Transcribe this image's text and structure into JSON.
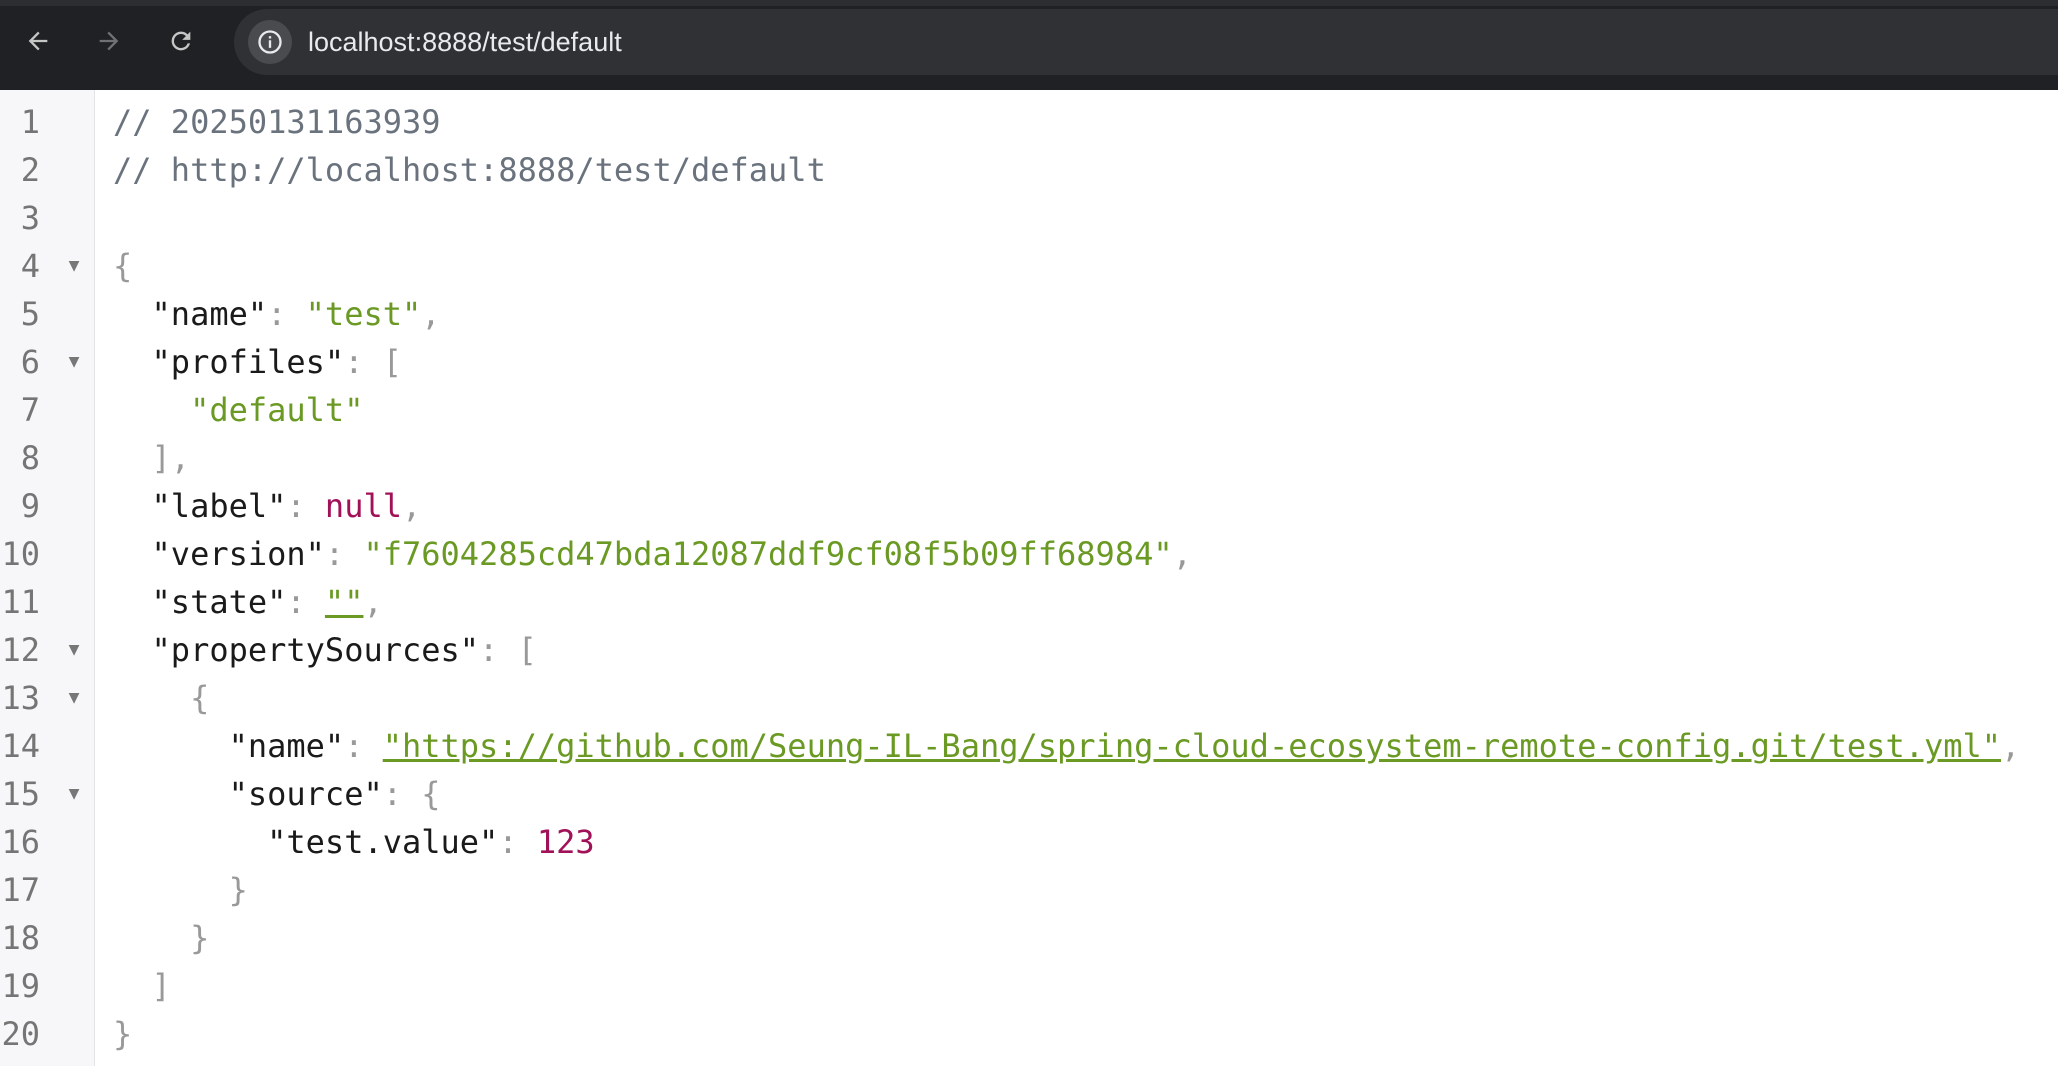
{
  "browser": {
    "url": "localhost:8888/test/default"
  },
  "lines": [
    {
      "n": "1",
      "fold": false,
      "indent": "",
      "parts": [
        {
          "t": "comment",
          "v": "// 20250131163939"
        }
      ]
    },
    {
      "n": "2",
      "fold": false,
      "indent": "",
      "parts": [
        {
          "t": "comment",
          "v": "// http://localhost:8888/test/default"
        }
      ]
    },
    {
      "n": "3",
      "fold": false,
      "indent": "",
      "parts": []
    },
    {
      "n": "4",
      "fold": true,
      "indent": "",
      "parts": [
        {
          "t": "punc",
          "v": "{"
        }
      ]
    },
    {
      "n": "5",
      "fold": false,
      "indent": "  ",
      "parts": [
        {
          "t": "key",
          "v": "\"name\""
        },
        {
          "t": "punc",
          "v": ": "
        },
        {
          "t": "str",
          "v": "\"test\""
        },
        {
          "t": "punc",
          "v": ","
        }
      ]
    },
    {
      "n": "6",
      "fold": true,
      "indent": "  ",
      "parts": [
        {
          "t": "key",
          "v": "\"profiles\""
        },
        {
          "t": "punc",
          "v": ": ["
        }
      ]
    },
    {
      "n": "7",
      "fold": false,
      "indent": "    ",
      "parts": [
        {
          "t": "str",
          "v": "\"default\""
        }
      ]
    },
    {
      "n": "8",
      "fold": false,
      "indent": "  ",
      "parts": [
        {
          "t": "punc",
          "v": "],"
        }
      ]
    },
    {
      "n": "9",
      "fold": false,
      "indent": "  ",
      "parts": [
        {
          "t": "key",
          "v": "\"label\""
        },
        {
          "t": "punc",
          "v": ": "
        },
        {
          "t": "null",
          "v": "null"
        },
        {
          "t": "punc",
          "v": ","
        }
      ]
    },
    {
      "n": "10",
      "fold": false,
      "indent": "  ",
      "parts": [
        {
          "t": "key",
          "v": "\"version\""
        },
        {
          "t": "punc",
          "v": ": "
        },
        {
          "t": "str",
          "v": "\"f7604285cd47bda12087ddf9cf08f5b09ff68984\""
        },
        {
          "t": "punc",
          "v": ","
        }
      ]
    },
    {
      "n": "11",
      "fold": false,
      "indent": "  ",
      "parts": [
        {
          "t": "key",
          "v": "\"state\""
        },
        {
          "t": "punc",
          "v": ": "
        },
        {
          "t": "link",
          "v": "\"\""
        },
        {
          "t": "punc",
          "v": ","
        }
      ]
    },
    {
      "n": "12",
      "fold": true,
      "indent": "  ",
      "parts": [
        {
          "t": "key",
          "v": "\"propertySources\""
        },
        {
          "t": "punc",
          "v": ": ["
        }
      ]
    },
    {
      "n": "13",
      "fold": true,
      "indent": "    ",
      "parts": [
        {
          "t": "punc",
          "v": "{"
        }
      ]
    },
    {
      "n": "14",
      "fold": false,
      "indent": "      ",
      "parts": [
        {
          "t": "key",
          "v": "\"name\""
        },
        {
          "t": "punc",
          "v": ": "
        },
        {
          "t": "link",
          "v": "\"https://github.com/Seung-IL-Bang/spring-cloud-ecosystem-remote-config.git/test.yml\""
        },
        {
          "t": "punc",
          "v": ","
        }
      ]
    },
    {
      "n": "15",
      "fold": true,
      "indent": "      ",
      "parts": [
        {
          "t": "key",
          "v": "\"source\""
        },
        {
          "t": "punc",
          "v": ": {"
        }
      ]
    },
    {
      "n": "16",
      "fold": false,
      "indent": "        ",
      "parts": [
        {
          "t": "key",
          "v": "\"test.value\""
        },
        {
          "t": "punc",
          "v": ": "
        },
        {
          "t": "num",
          "v": "123"
        }
      ]
    },
    {
      "n": "17",
      "fold": false,
      "indent": "      ",
      "parts": [
        {
          "t": "punc",
          "v": "}"
        }
      ]
    },
    {
      "n": "18",
      "fold": false,
      "indent": "    ",
      "parts": [
        {
          "t": "punc",
          "v": "}"
        }
      ]
    },
    {
      "n": "19",
      "fold": false,
      "indent": "  ",
      "parts": [
        {
          "t": "punc",
          "v": "]"
        }
      ]
    },
    {
      "n": "20",
      "fold": false,
      "indent": "",
      "parts": [
        {
          "t": "punc",
          "v": "}"
        }
      ]
    }
  ],
  "fold_glyph": "▼",
  "icons": {
    "back": "arrow-left-icon",
    "forward": "arrow-right-icon",
    "reload": "reload-icon",
    "site_info": "info-icon"
  }
}
